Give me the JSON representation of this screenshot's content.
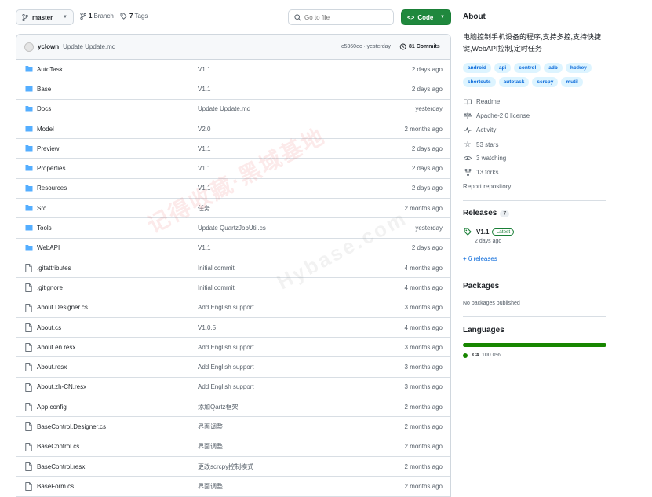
{
  "toolbar": {
    "branch": "master",
    "branches_count": "1",
    "branches_label": "Branch",
    "tags_count": "7",
    "tags_label": "Tags",
    "search_placeholder": "Go to file",
    "code_label": "Code"
  },
  "commit": {
    "author": "yclown",
    "message": "Update Update.md",
    "hash_time": "c5360ec · yesterday",
    "commits_label": "81 Commits"
  },
  "files": [
    {
      "name": "AutoTask",
      "type": "folder",
      "message": "V1.1",
      "age": "2 days ago"
    },
    {
      "name": "Base",
      "type": "folder",
      "message": "V1.1",
      "age": "2 days ago"
    },
    {
      "name": "Docs",
      "type": "folder",
      "message": "Update Update.md",
      "age": "yesterday"
    },
    {
      "name": "Model",
      "type": "folder",
      "message": "V2.0",
      "age": "2 months ago"
    },
    {
      "name": "Preview",
      "type": "folder",
      "message": "V1.1",
      "age": "2 days ago"
    },
    {
      "name": "Properties",
      "type": "folder",
      "message": "V1.1",
      "age": "2 days ago"
    },
    {
      "name": "Resources",
      "type": "folder",
      "message": "V1.1",
      "age": "2 days ago"
    },
    {
      "name": "Src",
      "type": "folder",
      "message": "任务",
      "age": "2 months ago"
    },
    {
      "name": "Tools",
      "type": "folder",
      "message": "Update QuartzJobUtil.cs",
      "age": "yesterday"
    },
    {
      "name": "WebAPI",
      "type": "folder",
      "message": "V1.1",
      "age": "2 days ago"
    },
    {
      "name": ".gitattributes",
      "type": "file",
      "message": "Initial commit",
      "age": "4 months ago"
    },
    {
      "name": ".gitignore",
      "type": "file",
      "message": "Initial commit",
      "age": "4 months ago"
    },
    {
      "name": "About.Designer.cs",
      "type": "file",
      "message": "Add English support",
      "age": "3 months ago"
    },
    {
      "name": "About.cs",
      "type": "file",
      "message": "V1.0.5",
      "age": "4 months ago"
    },
    {
      "name": "About.en.resx",
      "type": "file",
      "message": "Add English support",
      "age": "3 months ago"
    },
    {
      "name": "About.resx",
      "type": "file",
      "message": "Add English support",
      "age": "3 months ago"
    },
    {
      "name": "About.zh-CN.resx",
      "type": "file",
      "message": "Add English support",
      "age": "3 months ago"
    },
    {
      "name": "App.config",
      "type": "file",
      "message": "添加Qartz框架",
      "age": "2 months ago"
    },
    {
      "name": "BaseControl.Designer.cs",
      "type": "file",
      "message": "界面调整",
      "age": "2 months ago"
    },
    {
      "name": "BaseControl.cs",
      "type": "file",
      "message": "界面调整",
      "age": "2 months ago"
    },
    {
      "name": "BaseControl.resx",
      "type": "file",
      "message": "更改scrcpy控制模式",
      "age": "2 months ago"
    },
    {
      "name": "BaseForm.cs",
      "type": "file",
      "message": "界面调整",
      "age": "2 months ago"
    }
  ],
  "about": {
    "heading": "About",
    "description": "电脑控制手机设备的程序,支持多控,支持快捷键,WebAPI控制,定时任务",
    "topics": [
      "android",
      "api",
      "control",
      "adb",
      "hotkey",
      "shortcuts",
      "autotask",
      "scrcpy",
      "mutil"
    ],
    "readme": "Readme",
    "license": "Apache-2.0 license",
    "activity": "Activity",
    "stars": "53 stars",
    "watching": "3 watching",
    "forks": "13 forks",
    "report": "Report repository"
  },
  "releases": {
    "heading": "Releases",
    "count": "7",
    "latest_name": "V1.1",
    "latest_badge": "Latest",
    "latest_date": "2 days ago",
    "more": "+ 6 releases"
  },
  "packages": {
    "heading": "Packages",
    "note": "No packages published"
  },
  "languages": {
    "heading": "Languages",
    "name": "C#",
    "percent": "100.0%"
  },
  "watermark": {
    "text1": "记得收藏·黑域基地",
    "text2": "Hybase.com"
  },
  "colors": {
    "code_button": "#1f883d",
    "link_blue": "#0969da",
    "folder_blue": "#54aeff",
    "csharp_green": "#178600"
  }
}
